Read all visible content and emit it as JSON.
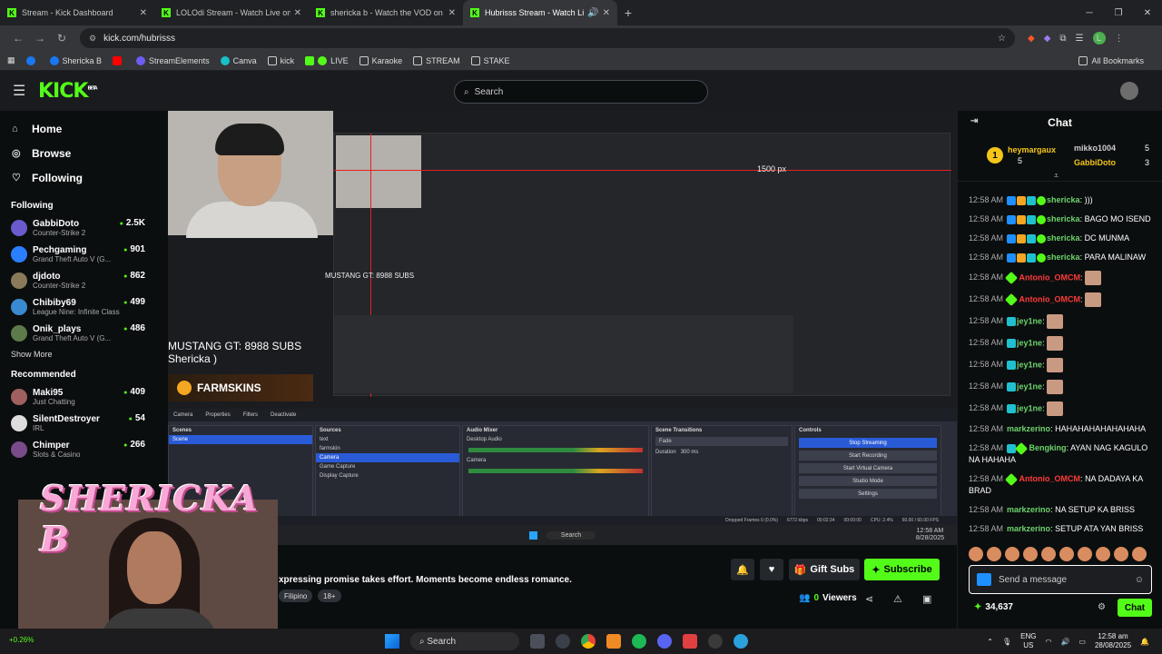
{
  "browser": {
    "tabs": [
      {
        "title": "Stream - Kick Dashboard",
        "active": false
      },
      {
        "title": "LOLOdi Stream - Watch Live on",
        "active": false
      },
      {
        "title": "shericka b - Watch the VOD on",
        "active": false
      },
      {
        "title": "Hubrisss Stream - Watch Li",
        "active": true
      }
    ],
    "url": "kick.com/hubrisss",
    "bookmarks": [
      {
        "label": "",
        "icon": "facebook-icon"
      },
      {
        "label": "Shericka B",
        "icon": "facebook-icon"
      },
      {
        "label": "",
        "icon": "youtube-icon"
      },
      {
        "label": "StreamElements",
        "icon": "streamelements-icon"
      },
      {
        "label": "Canva",
        "icon": "canva-icon"
      },
      {
        "label": "kick",
        "icon": "folder-icon"
      },
      {
        "label": "LIVE",
        "icon": "kick-icon"
      },
      {
        "label": "Karaoke",
        "icon": "folder-icon"
      },
      {
        "label": "STREAM",
        "icon": "folder-icon"
      },
      {
        "label": "STAKE",
        "icon": "folder-icon"
      }
    ],
    "all_bookmarks": "All Bookmarks",
    "profile_letter": "L"
  },
  "kick": {
    "logo": "KICK",
    "logo_beta": "BETA",
    "search_placeholder": "Search"
  },
  "sidebar": {
    "nav": [
      {
        "label": "Home",
        "icon": "home-icon"
      },
      {
        "label": "Browse",
        "icon": "compass-icon"
      },
      {
        "label": "Following",
        "icon": "heart-icon"
      }
    ],
    "following_title": "Following",
    "following": [
      {
        "name": "GabbiDoto",
        "game": "Counter-Strike 2",
        "viewers": "2.5K",
        "color": "#6a5acd"
      },
      {
        "name": "Pechgaming",
        "game": "Grand Theft Auto V (G...",
        "viewers": "901",
        "color": "#2a7fff"
      },
      {
        "name": "djdoto",
        "game": "Counter-Strike 2",
        "viewers": "862",
        "color": "#8a7a5a"
      },
      {
        "name": "Chibiby69",
        "game": "League Nine: Infinite Class",
        "viewers": "499",
        "color": "#3a8ad1"
      },
      {
        "name": "Onik_plays",
        "game": "Grand Theft Auto V (G...",
        "viewers": "486",
        "color": "#5d7a4a"
      }
    ],
    "show_more": "Show More",
    "recommended_title": "Recommended",
    "recommended": [
      {
        "name": "Maki95",
        "game": "Just Chatting",
        "viewers": "409",
        "color": "#a06060"
      },
      {
        "name": "SilentDestroyer",
        "game": "IRL",
        "viewers": "54",
        "color": "#dddddd"
      },
      {
        "name": "Chimper",
        "game": "Slots & Casino",
        "viewers": "266",
        "color": "#7a4a8a"
      }
    ]
  },
  "video": {
    "overlay_text_1": "MUSTANG GT: 8988 SUBS",
    "overlay_text_2": "Shericka )",
    "farmskins": "FARMSKINS",
    "nested_distance": "1500 px",
    "obs": {
      "top_buttons": [
        "Camera",
        "Properties",
        "Filters",
        "Deactivate"
      ],
      "scenes_title": "Scenes",
      "scenes": [
        "Scene"
      ],
      "sources_title": "Sources",
      "sources": [
        "text",
        "farmskin",
        "Camera",
        "Game Capture",
        "Display Capture"
      ],
      "mixer_title": "Audio Mixer",
      "mixer": [
        {
          "name": "Desktop Audio",
          "db": "0.0 dB"
        },
        {
          "name": "Camera",
          "db": "0.0 dB"
        }
      ],
      "transitions_title": "Scene Transitions",
      "transition": "Fade",
      "duration_label": "Duration",
      "duration": "300 ms",
      "controls_title": "Controls",
      "controls": [
        "Stop Streaming",
        "Start Recording",
        "Start Virtual Camera",
        "Studio Mode",
        "Settings"
      ],
      "status": [
        "Dropped Frames 0 (0.0%)",
        "6772 kbps",
        "00:02:34",
        "00:00:00",
        "CPU: 2.4%",
        "60.00 / 60.00 FPS"
      ],
      "inner_taskbar_search": "Search",
      "inner_clock": "12:58 AM",
      "inner_date": "8/28/2025"
    }
  },
  "streamer_overlay": {
    "name": "SHERICKA B"
  },
  "stream_info": {
    "title": "xpressing promise takes effort. Moments become endless romance.",
    "tags": [
      "Filipino",
      "18+"
    ],
    "gift_subs": "Gift Subs",
    "subscribe": "Subscribe",
    "viewers_count": "0",
    "viewers_label": "Viewers"
  },
  "chat": {
    "title": "Chat",
    "leaderboard": [
      {
        "rank": "1",
        "name": "heymargaux",
        "count": "5",
        "color": "#f5c518"
      },
      {
        "name": "mikko1004",
        "count": "5",
        "color": "#cccccc"
      },
      {
        "name": "GabbiDoto",
        "count": "3",
        "color": "#f5c518"
      }
    ],
    "messages": [
      {
        "time": "12:58 AM",
        "user": "shericka",
        "color": "#6cd46c",
        "text": ")))"
      },
      {
        "time": "12:58 AM",
        "user": "shericka",
        "color": "#6cd46c",
        "text": "BAGO MO ISEND"
      },
      {
        "time": "12:58 AM",
        "user": "shericka",
        "color": "#6cd46c",
        "text": "DC MUNMA"
      },
      {
        "time": "12:58 AM",
        "user": "shericka",
        "color": "#6cd46c",
        "text": "PARA MALINAW"
      },
      {
        "time": "12:58 AM",
        "user": "Antonio_OMCM",
        "color": "#ff3a3a",
        "text": ""
      },
      {
        "time": "12:58 AM",
        "user": "Antonio_OMCM",
        "color": "#ff3a3a",
        "text": ""
      },
      {
        "time": "12:58 AM",
        "user": "jey1ne",
        "color": "#6cd46c",
        "text": ""
      },
      {
        "time": "12:58 AM",
        "user": "jey1ne",
        "color": "#6cd46c",
        "text": ""
      },
      {
        "time": "12:58 AM",
        "user": "jey1ne",
        "color": "#6cd46c",
        "text": ""
      },
      {
        "time": "12:58 AM",
        "user": "jey1ne",
        "color": "#6cd46c",
        "text": ""
      },
      {
        "time": "12:58 AM",
        "user": "jey1ne",
        "color": "#6cd46c",
        "text": ""
      },
      {
        "time": "12:58 AM",
        "user": "markzerino",
        "color": "#6cd46c",
        "text": "HAHAHAHAHAHAHAHA"
      },
      {
        "time": "12:58 AM",
        "user": "Bengking",
        "color": "#6cd46c",
        "text": "AYAN NAG KAGULO NA HAHAHA"
      },
      {
        "time": "12:58 AM",
        "user": "Antonio_OMCM",
        "color": "#ff3a3a",
        "text": "NA DADAYA KA BRAD"
      },
      {
        "time": "12:58 AM",
        "user": "markzerino",
        "color": "#6cd46c",
        "text": "NA SETUP KA BRISS"
      },
      {
        "time": "12:58 AM",
        "user": "markzerino",
        "color": "#6cd46c",
        "text": "SETUP ATA YAN BRISS"
      }
    ],
    "input_placeholder": "Send a message",
    "points": "34,637",
    "send_label": "Chat"
  },
  "taskbar": {
    "search": "Search",
    "lang_1": "ENG",
    "lang_2": "US",
    "time": "12:58 am",
    "date": "28/08/2025",
    "left_text": "+0.26%"
  }
}
